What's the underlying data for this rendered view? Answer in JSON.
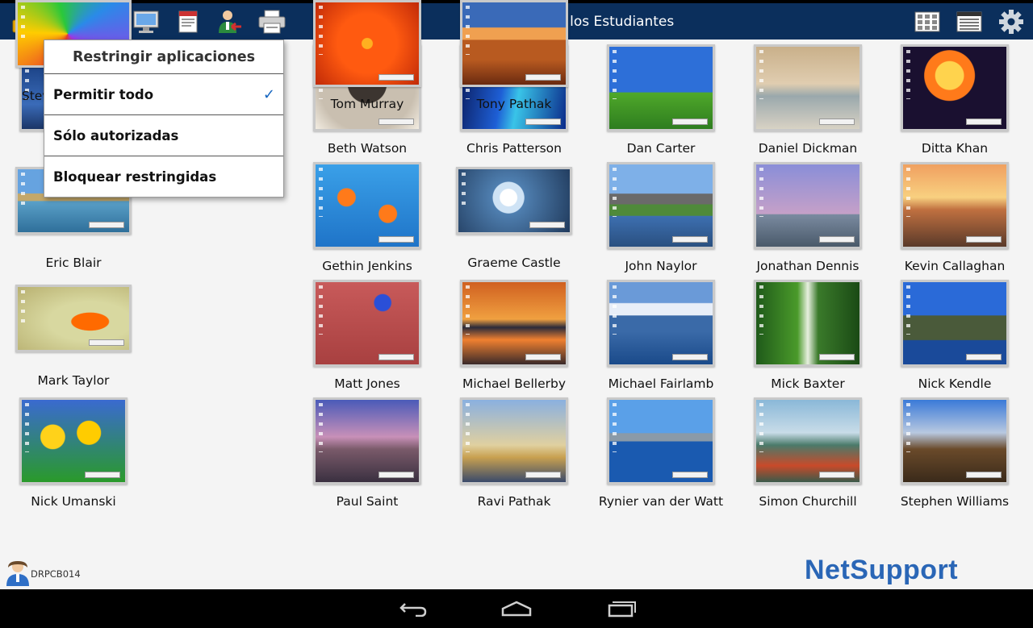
{
  "header": {
    "title": "Todos los Estudiantes",
    "left_icons": [
      "lock-icon",
      "window-icon",
      "globe-icon",
      "monitor-icon",
      "message-icon",
      "user-logout-icon",
      "printer-icon"
    ],
    "right_icons": [
      "thumbnail-grid-icon",
      "list-view-icon",
      "gear-icon"
    ]
  },
  "menu": {
    "title": "Restringir aplicaciones",
    "items": [
      {
        "label": "Permitir todo",
        "checked": true
      },
      {
        "label": "Sólo autorizadas",
        "checked": false
      },
      {
        "label": "Bloquear restringidas",
        "checked": false
      }
    ],
    "check": "✓"
  },
  "students": [
    {
      "name": "",
      "wallpaper": "moon-night"
    },
    {
      "name": "Beth Watson",
      "wallpaper": "dog-sepia"
    },
    {
      "name": "Chris Patterson",
      "wallpaper": "aurora-blue"
    },
    {
      "name": "Dan Carter",
      "wallpaper": "green-hill"
    },
    {
      "name": "Daniel Dickman",
      "wallpaper": "lake-boats"
    },
    {
      "name": "Ditta Khan",
      "wallpaper": "fireworks"
    },
    {
      "name": "Eric Blair",
      "wallpaper": "mountain-lake"
    },
    {
      "name": "Gethin Jenkins",
      "wallpaper": "orange-fish"
    },
    {
      "name": "Graeme Castle",
      "wallpaper": "dandelion"
    },
    {
      "name": "John Naylor",
      "wallpaper": "mountain-stream"
    },
    {
      "name": "Jonathan Dennis",
      "wallpaper": "stonehenge"
    },
    {
      "name": "Kevin Callaghan",
      "wallpaper": "sunset-rocks"
    },
    {
      "name": "Mark Taylor",
      "wallpaper": "orange-leaf"
    },
    {
      "name": "Matt Jones",
      "wallpaper": "red-wall-window"
    },
    {
      "name": "Michael Bellerby",
      "wallpaper": "orange-sunset"
    },
    {
      "name": "Michael Fairlamb",
      "wallpaper": "mountain-lake-blue"
    },
    {
      "name": "Mick Baxter",
      "wallpaper": "forest-waterfall"
    },
    {
      "name": "Nick Kendle",
      "wallpaper": "coastal-cliff"
    },
    {
      "name": "Nick Umanski",
      "wallpaper": "yellow-tulips"
    },
    {
      "name": "Paul Saint",
      "wallpaper": "lighthouse-dusk"
    },
    {
      "name": "Ravi Pathak",
      "wallpaper": "tower-bridge"
    },
    {
      "name": "Rynier van der Watt",
      "wallpaper": "harbour-city"
    },
    {
      "name": "Simon Churchill",
      "wallpaper": "misty-lake-canoe"
    },
    {
      "name": "Stephen Williams",
      "wallpaper": "baobab-trees"
    },
    {
      "name": "Steven Granville",
      "wallpaper": "hot-air-balloon"
    },
    {
      "name": "Tom Murray",
      "wallpaper": "orange-flower"
    },
    {
      "name": "Tony Pathak",
      "wallpaper": "desert-monument"
    }
  ],
  "footer": {
    "username": "DRPCB014",
    "logo": "NetSupport"
  },
  "navbar": {
    "buttons": [
      "back-icon",
      "home-icon",
      "recent-apps-icon"
    ]
  },
  "colors": {
    "toolbar": "#0b2f5c",
    "accent": "#1565c0",
    "logo": "#2a66b6"
  }
}
